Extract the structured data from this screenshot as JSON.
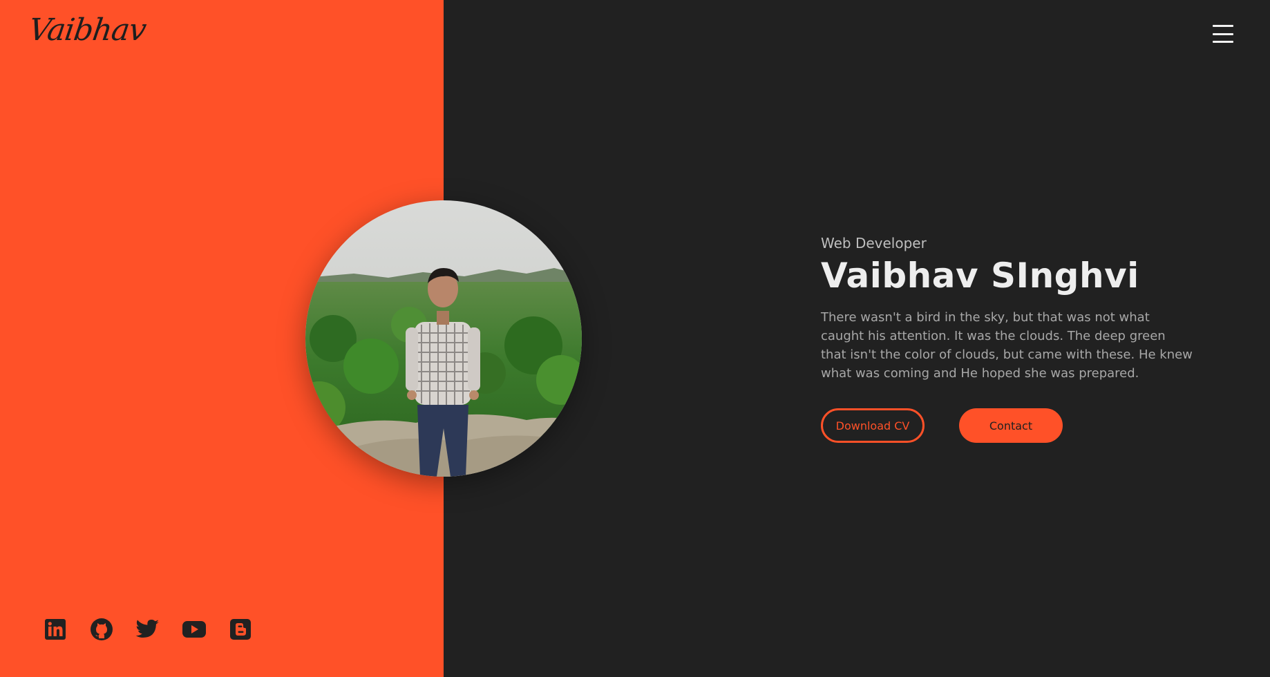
{
  "brand": {
    "logo_text": "Vaibhav"
  },
  "hero": {
    "role": "Web Developer",
    "name": "Vaibhav SInghvi",
    "bio": "There wasn't a bird in the sky, but that was not what caught his attention. It was the clouds. The deep green that isn't the color of clouds, but came with these. He knew what was coming and He hoped she was prepared.",
    "download_cv_label": "Download CV",
    "contact_label": "Contact"
  },
  "social": [
    "linkedin-icon",
    "github-icon",
    "twitter-icon",
    "youtube-icon",
    "blogger-icon"
  ],
  "colors": {
    "accent": "#ff5128",
    "dark": "#212121",
    "text_light": "#eeeeee",
    "text_muted": "#a8a8a8"
  }
}
